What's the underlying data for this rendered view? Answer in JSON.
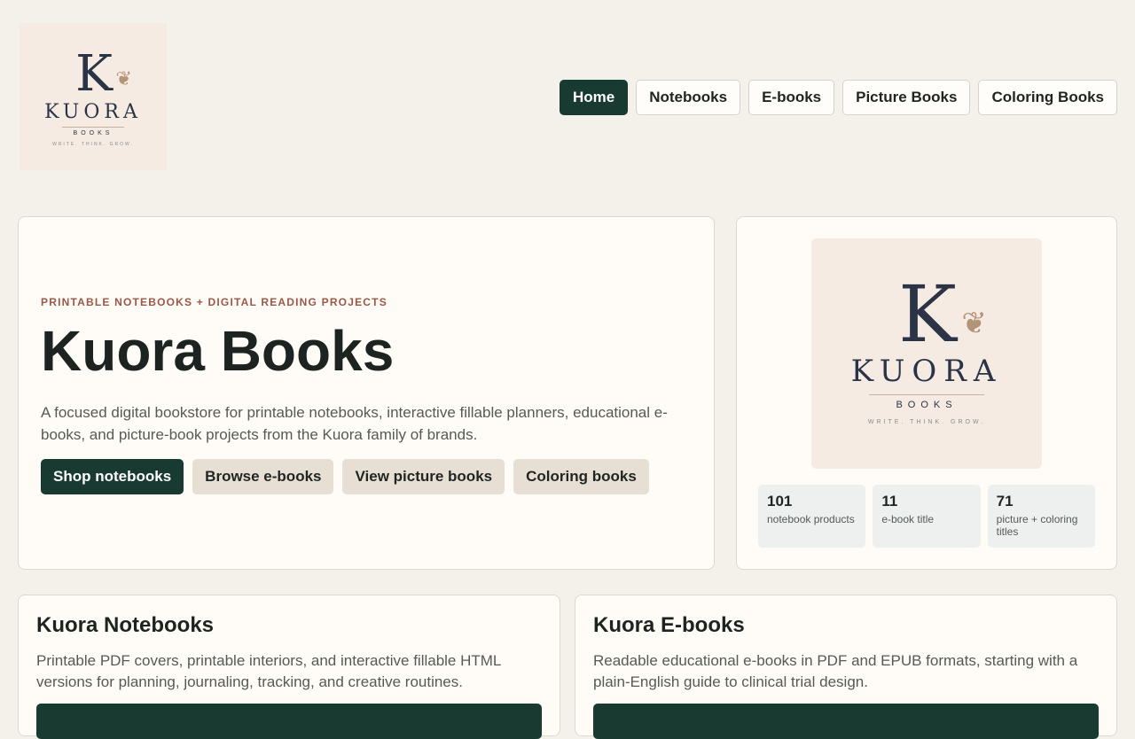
{
  "logo": {
    "letter": "K",
    "word": "KUORA",
    "sub": "BOOKS",
    "tagline": "WRITE. THINK. GROW."
  },
  "nav": {
    "items": [
      {
        "label": "Home",
        "active": true
      },
      {
        "label": "Notebooks"
      },
      {
        "label": "E-books"
      },
      {
        "label": "Picture Books"
      },
      {
        "label": "Coloring Books"
      }
    ]
  },
  "hero": {
    "eyebrow": "PRINTABLE NOTEBOOKS + DIGITAL READING PROJECTS",
    "title": "Kuora Books",
    "description": "A focused digital bookstore for printable notebooks, interactive fillable planners, educational e-books, and picture-book projects from the Kuora family of brands.",
    "buttons": [
      "Shop notebooks",
      "Browse e-books",
      "View picture books",
      "Coloring books"
    ]
  },
  "stats": [
    {
      "number": "101",
      "label": "notebook products"
    },
    {
      "number": "11",
      "label": "e-book title"
    },
    {
      "number": "71",
      "label": "picture + coloring titles"
    }
  ],
  "brands": [
    {
      "title": "Kuora Notebooks",
      "description": "Printable PDF covers, printable interiors, and interactive fillable HTML versions for planning, journaling, tracking, and creative routines."
    },
    {
      "title": "Kuora E-books",
      "description": "Readable educational e-books in PDF and EPUB formats, starting with a plain-English guide to clinical trial design."
    }
  ]
}
